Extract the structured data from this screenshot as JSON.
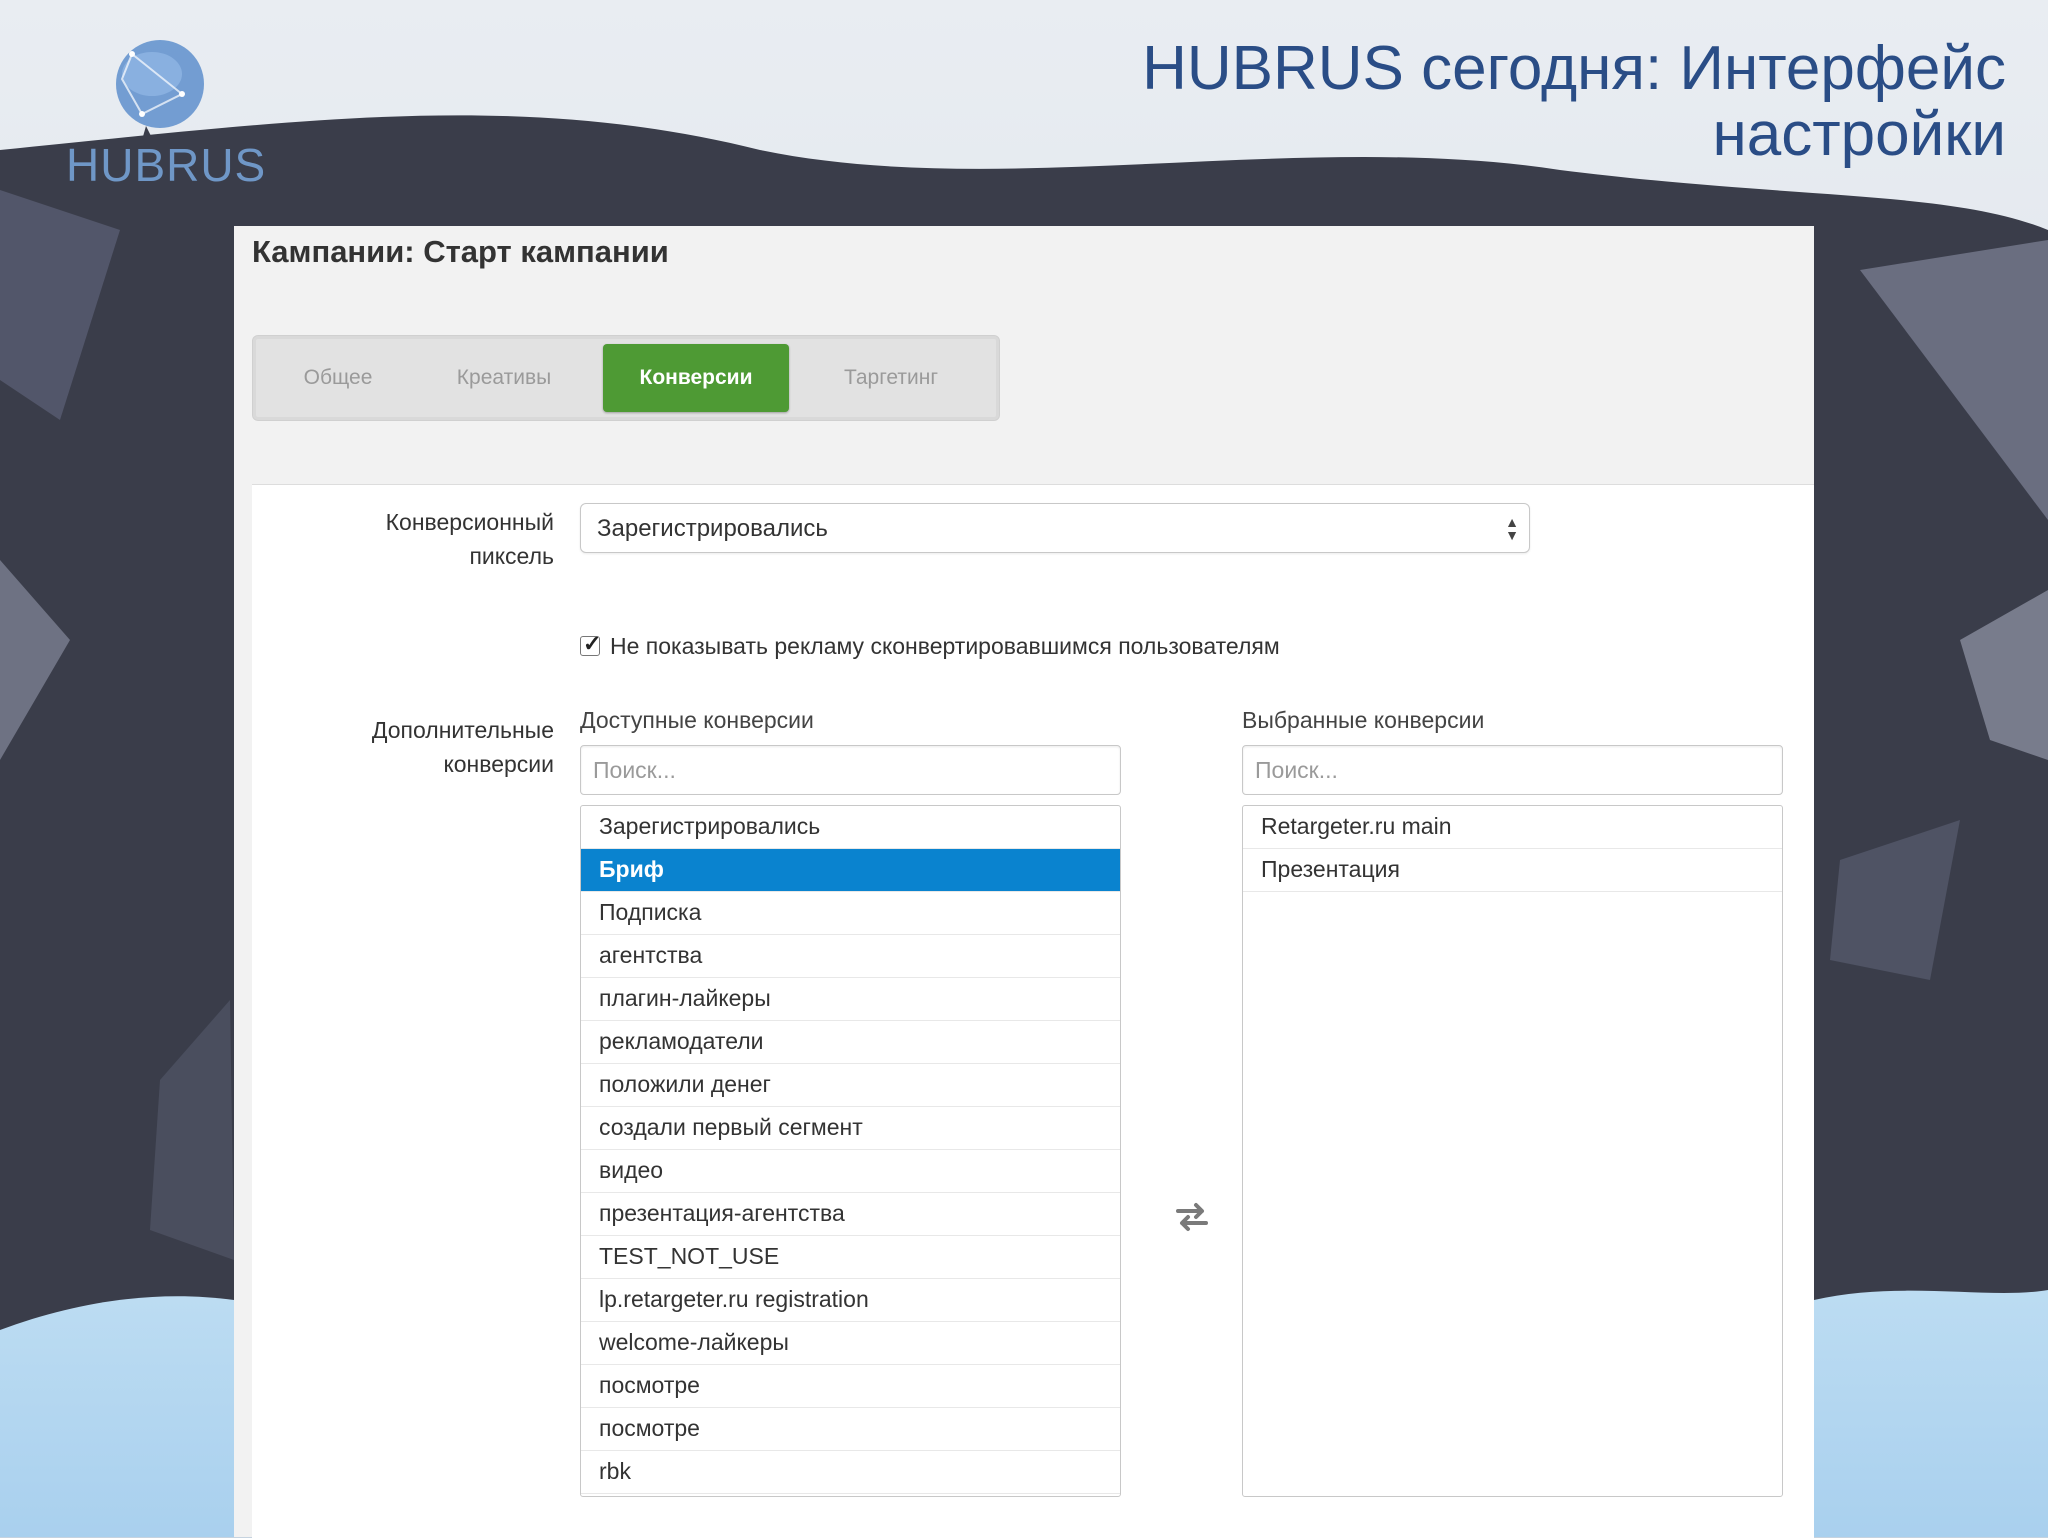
{
  "slide": {
    "title": "HUBRUS сегодня: Интерфейс настройки",
    "logo_text": "HUBRUS"
  },
  "panel": {
    "title": "Кампании: Старт кампании",
    "tabs": [
      {
        "label": "Общее",
        "active": false
      },
      {
        "label": "Креативы",
        "active": false
      },
      {
        "label": "Конверсии",
        "active": true
      },
      {
        "label": "Таргетинг",
        "active": false
      }
    ]
  },
  "form": {
    "pixel_label": "Конверсионный пиксель",
    "pixel_value": "Зарегистрировались",
    "checkbox_label": "Не показывать рекламу сконвертировавшимся пользователям",
    "checkbox_checked": true,
    "extra_label": "Дополнительные конверсии",
    "available": {
      "header": "Доступные конверсии",
      "search_placeholder": "Поиск...",
      "items": [
        "Зарегистрировались",
        "Бриф",
        "Подписка",
        "агентства",
        "плагин-лайкеры",
        "рекламодатели",
        "положили денег",
        "создали первый сегмент",
        "видео",
        "презентация-агентства",
        "TEST_NOT_USE",
        "lp.retargeter.ru registration",
        "welcome-лайкеры",
        "посмотре",
        "посмотре",
        "rbk"
      ],
      "selected_item": "Бриф"
    },
    "chosen": {
      "header": "Выбранные конверсии",
      "search_placeholder": "Поиск...",
      "items": [
        "Retargeter.ru main",
        "Презентация"
      ]
    },
    "swap_icon": "swap-arrows-icon"
  },
  "colors": {
    "title": "#2a4d86",
    "tab_active": "#4e9a34",
    "selection": "#0a83cf"
  }
}
